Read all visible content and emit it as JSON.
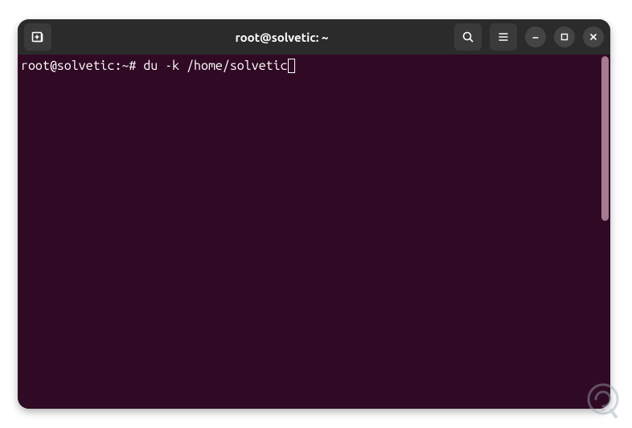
{
  "window": {
    "title": "root@solvetic: ~"
  },
  "terminal": {
    "prompt": "root@solvetic:~# ",
    "command": "du -k /home/solvetic"
  },
  "icons": {
    "new_tab": "new-tab",
    "search": "search",
    "menu": "menu",
    "minimize": "minimize",
    "maximize": "maximize",
    "close": "close"
  }
}
